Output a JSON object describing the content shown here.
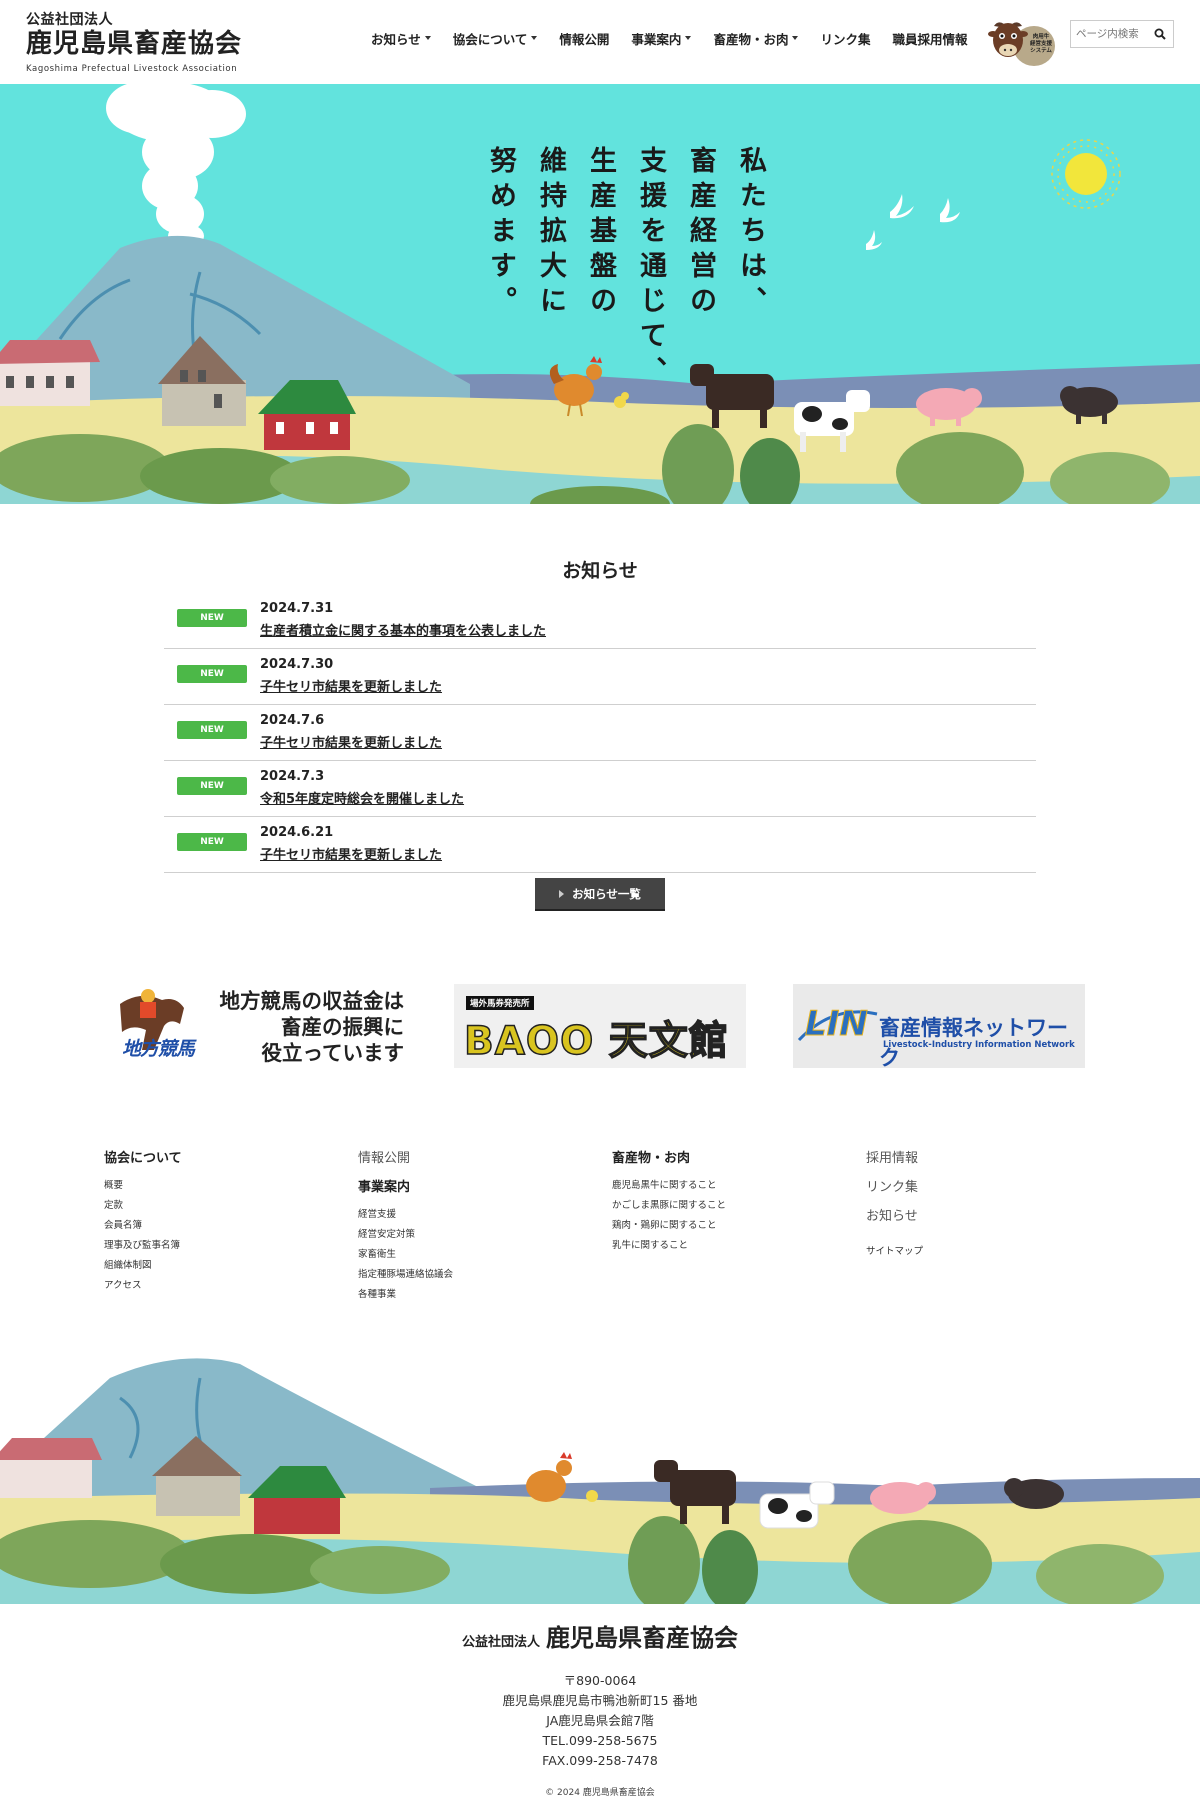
{
  "header": {
    "org_type": "公益社団法人",
    "org_name": "鹿児島県畜産協会",
    "org_name_en": "Kagoshima Prefectual Livestock Association",
    "nav": [
      {
        "label": "お知らせ",
        "dropdown": true
      },
      {
        "label": "協会について",
        "dropdown": true
      },
      {
        "label": "情報公開",
        "dropdown": false
      },
      {
        "label": "事業案内",
        "dropdown": true
      },
      {
        "label": "畜産物・お肉",
        "dropdown": true
      },
      {
        "label": "リンク集",
        "dropdown": false
      },
      {
        "label": "職員採用情報",
        "dropdown": false
      }
    ],
    "badge_text": [
      "肉用牛",
      "経営支援",
      "システム"
    ],
    "search_placeholder": "ページ内検索"
  },
  "hero": {
    "tagline_columns": [
      "私たちは、",
      "畜産経営の",
      "支援を通じて、",
      "生産基盤の",
      "維持拡大に",
      "努めます。"
    ],
    "sky_color": "#62e3dd"
  },
  "news": {
    "title": "お知らせ",
    "items": [
      {
        "badge": "NEW",
        "date": "2024.7.31",
        "title": "生産者積立金に関する基本的事項を公表しました"
      },
      {
        "badge": "NEW",
        "date": "2024.7.30",
        "title": "子牛セリ市結果を更新しました"
      },
      {
        "badge": "NEW",
        "date": "2024.7.6",
        "title": "子牛セリ市結果を更新しました"
      },
      {
        "badge": "NEW",
        "date": "2024.7.3",
        "title": "令和5年度定時総会を開催しました"
      },
      {
        "badge": "NEW",
        "date": "2024.6.21",
        "title": "子牛セリ市結果を更新しました"
      }
    ],
    "more_label": "お知らせ一覧",
    "badge_color": "#4cb848"
  },
  "banners": {
    "chihou": {
      "logo_text": "地方競馬",
      "lines": [
        "地方競馬の収益金は",
        "畜産の振興に",
        "役立っています"
      ]
    },
    "baoo": {
      "small": "場外馬券発売所",
      "big": "BAOO 天文館"
    },
    "lin": {
      "logo": "LIN",
      "jp": "畜産情報ネットワーク",
      "en": "Livestock-Industry Information Network"
    }
  },
  "footer_nav": {
    "col1": {
      "head": "協会について",
      "links": [
        "概要",
        "定款",
        "会員名簿",
        "理事及び監事名簿",
        "組織体制図",
        "アクセス"
      ]
    },
    "col2": {
      "head1": "情報公開",
      "head2": "事業案内",
      "links": [
        "経営支援",
        "経営安定対策",
        "家畜衛生",
        "指定種豚場連絡協議会",
        "各種事業"
      ]
    },
    "col3": {
      "head": "畜産物・お肉",
      "links": [
        "鹿児島黒牛に関すること",
        "かごしま黒豚に関すること",
        "鶏肉・鶏卵に関すること",
        "乳牛に関すること"
      ]
    },
    "col4": {
      "heads": [
        "採用情報",
        "リンク集",
        "お知らせ"
      ],
      "sitemap": "サイトマップ"
    }
  },
  "footer": {
    "org_type": "公益社団法人",
    "org_name": "鹿児島県畜産協会",
    "address_lines": [
      "〒890-0064",
      "鹿児島県鹿児島市鴨池新町15 番地",
      "JA鹿児島県会館7階",
      "TEL.099-258-5675",
      "FAX.099-258-7478"
    ],
    "copyright": "© 2024 鹿児島県畜産協会"
  }
}
